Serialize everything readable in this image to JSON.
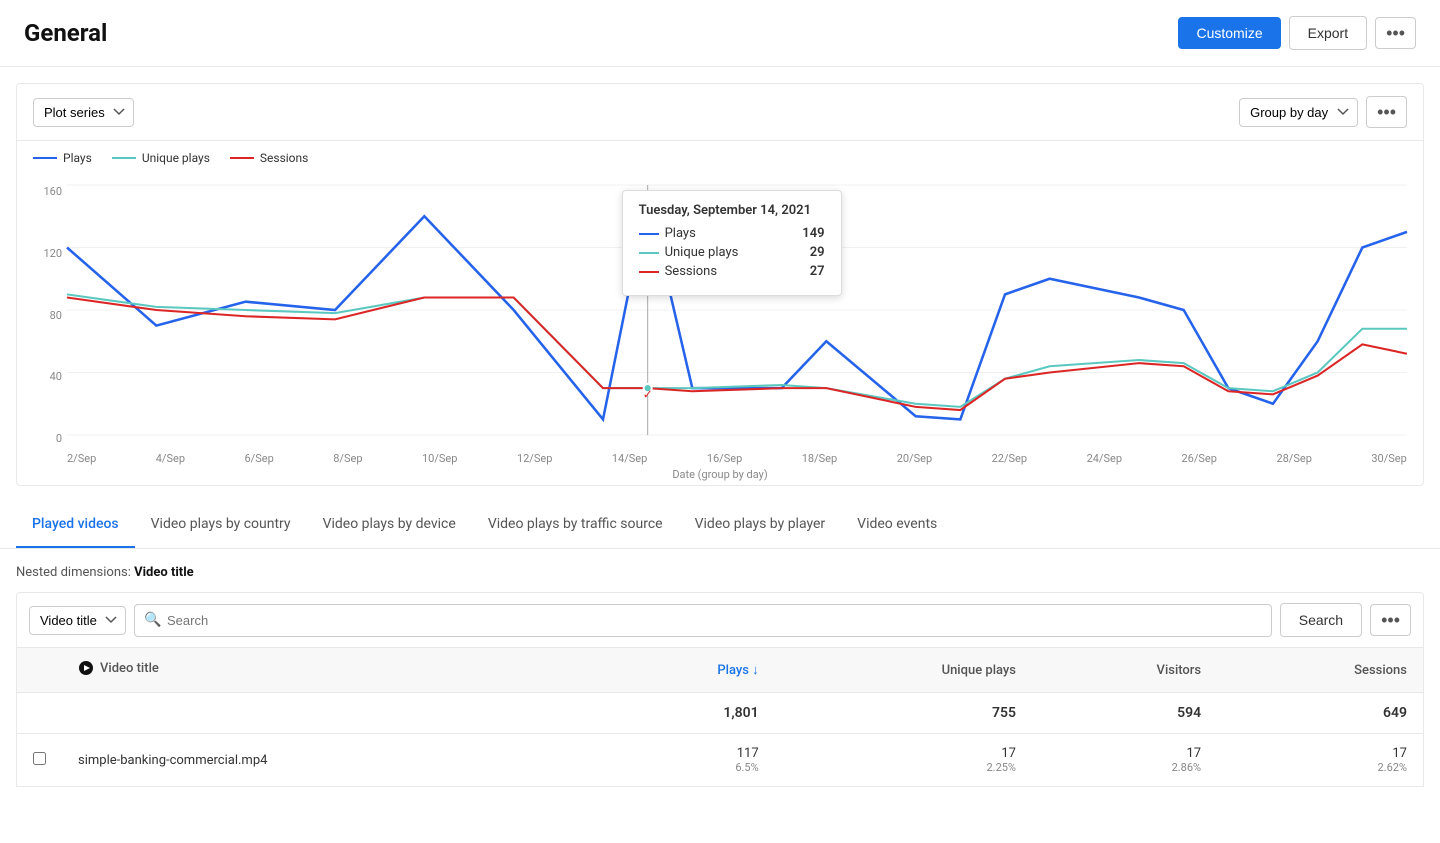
{
  "header": {
    "title": "General",
    "customize_label": "Customize",
    "export_label": "Export",
    "more_icon": "•••"
  },
  "chart_toolbar": {
    "plot_series_label": "Plot series",
    "group_by_label": "Group by day",
    "more_icon": "•••"
  },
  "legend": {
    "items": [
      {
        "label": "Plays",
        "color": "#2563eb"
      },
      {
        "label": "Unique plays",
        "color": "#5bc8c0"
      },
      {
        "label": "Sessions",
        "color": "#dc2626"
      }
    ]
  },
  "tooltip": {
    "date": "Tuesday, September 14, 2021",
    "rows": [
      {
        "label": "Plays",
        "value": "149",
        "color": "#2563eb"
      },
      {
        "label": "Unique plays",
        "value": "29",
        "color": "#5bc8c0"
      },
      {
        "label": "Sessions",
        "value": "27",
        "color": "#dc2626"
      }
    ]
  },
  "chart": {
    "y_labels": [
      "0",
      "40",
      "80",
      "120",
      "160"
    ],
    "x_labels": [
      "2/Sep",
      "4/Sep",
      "6/Sep",
      "8/Sep",
      "10/Sep",
      "12/Sep",
      "14/Sep",
      "16/Sep",
      "18/Sep",
      "20/Sep",
      "22/Sep",
      "24/Sep",
      "26/Sep",
      "28/Sep",
      "30/Sep"
    ],
    "x_axis_title": "Date (group by day)"
  },
  "tabs": [
    {
      "label": "Played videos",
      "active": true
    },
    {
      "label": "Video plays by country",
      "active": false
    },
    {
      "label": "Video plays by device",
      "active": false
    },
    {
      "label": "Video plays by traffic source",
      "active": false
    },
    {
      "label": "Video plays by player",
      "active": false
    },
    {
      "label": "Video events",
      "active": false
    }
  ],
  "nested_dims": {
    "label": "Nested dimensions:",
    "value": "Video title"
  },
  "table_controls": {
    "dimension_label": "Video title",
    "search_placeholder": "Search",
    "search_button_label": "Search",
    "more_icon": "•••"
  },
  "table": {
    "columns": [
      {
        "label": "",
        "key": "checkbox"
      },
      {
        "label": "Video title",
        "key": "title",
        "sortable": false
      },
      {
        "label": "Plays",
        "key": "plays",
        "sortable": true
      },
      {
        "label": "Unique plays",
        "key": "unique_plays"
      },
      {
        "label": "Visitors",
        "key": "visitors"
      },
      {
        "label": "Sessions",
        "key": "sessions"
      }
    ],
    "total_row": {
      "plays": "1,801",
      "unique_plays": "755",
      "visitors": "594",
      "sessions": "649"
    },
    "rows": [
      {
        "title": "simple-banking-commercial.mp4",
        "plays": "117",
        "plays_pct": "6.5%",
        "unique_plays": "17",
        "unique_plays_pct": "2.25%",
        "visitors": "17",
        "visitors_pct": "2.86%",
        "sessions": "17",
        "sessions_pct": "2.62%"
      }
    ]
  }
}
